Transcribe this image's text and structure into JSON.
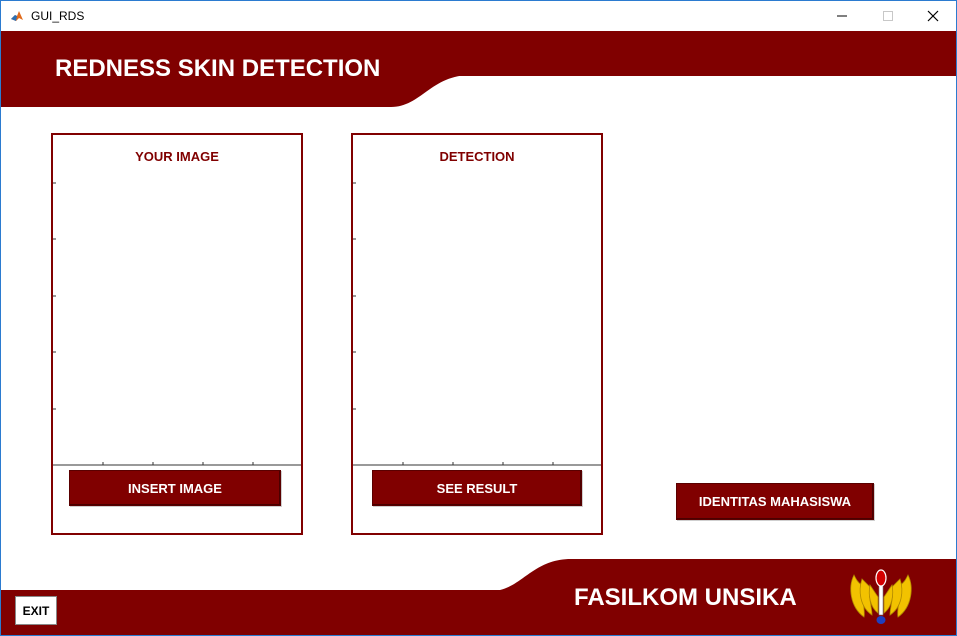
{
  "window": {
    "title": "GUI_RDS",
    "controls": {
      "minimize": "minimize",
      "maximize": "maximize",
      "close": "close"
    }
  },
  "header": {
    "title": "REDNESS SKIN DETECTION"
  },
  "panels": {
    "input": {
      "title": "YOUR IMAGE",
      "button_label": "INSERT IMAGE"
    },
    "result": {
      "title": "DETECTION",
      "button_label": "SEE RESULT"
    }
  },
  "identity_button_label": "IDENTITAS MAHASISWA",
  "footer": {
    "title": "FASILKOM UNSIKA",
    "logo_icon": "unsika-logo"
  },
  "exit_label": "EXIT",
  "colors": {
    "brand": "#800000",
    "logo_gold": "#f2c200",
    "logo_blue": "#1f3fbf",
    "logo_red": "#d40000"
  }
}
